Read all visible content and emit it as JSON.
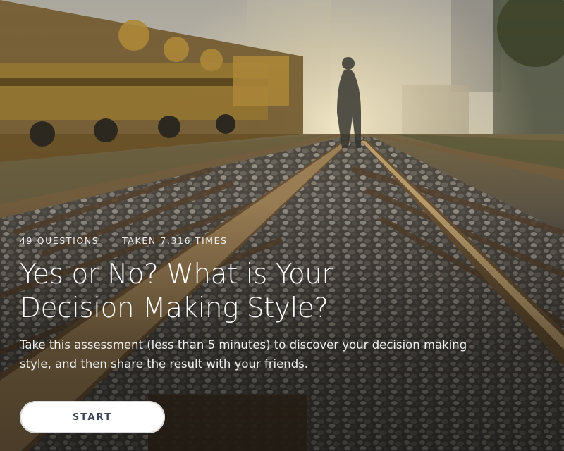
{
  "quiz": {
    "questions_count": "49 QUESTIONS",
    "separator": "·",
    "taken_count": "TAKEN 7,316 TIMES",
    "title": "Yes or No? What is Your Decision Making Style?",
    "description": "Take this assessment (less than 5 minutes) to discover your decision making style, and then share the result with your friends.",
    "start_label": "START"
  },
  "background": {
    "subject": "railway-tracks-photo",
    "colors": {
      "sky": "#c8c2b4",
      "haze": "#f2e7c8",
      "train": "#8a6a2a",
      "gravel": "#6b655c"
    }
  }
}
